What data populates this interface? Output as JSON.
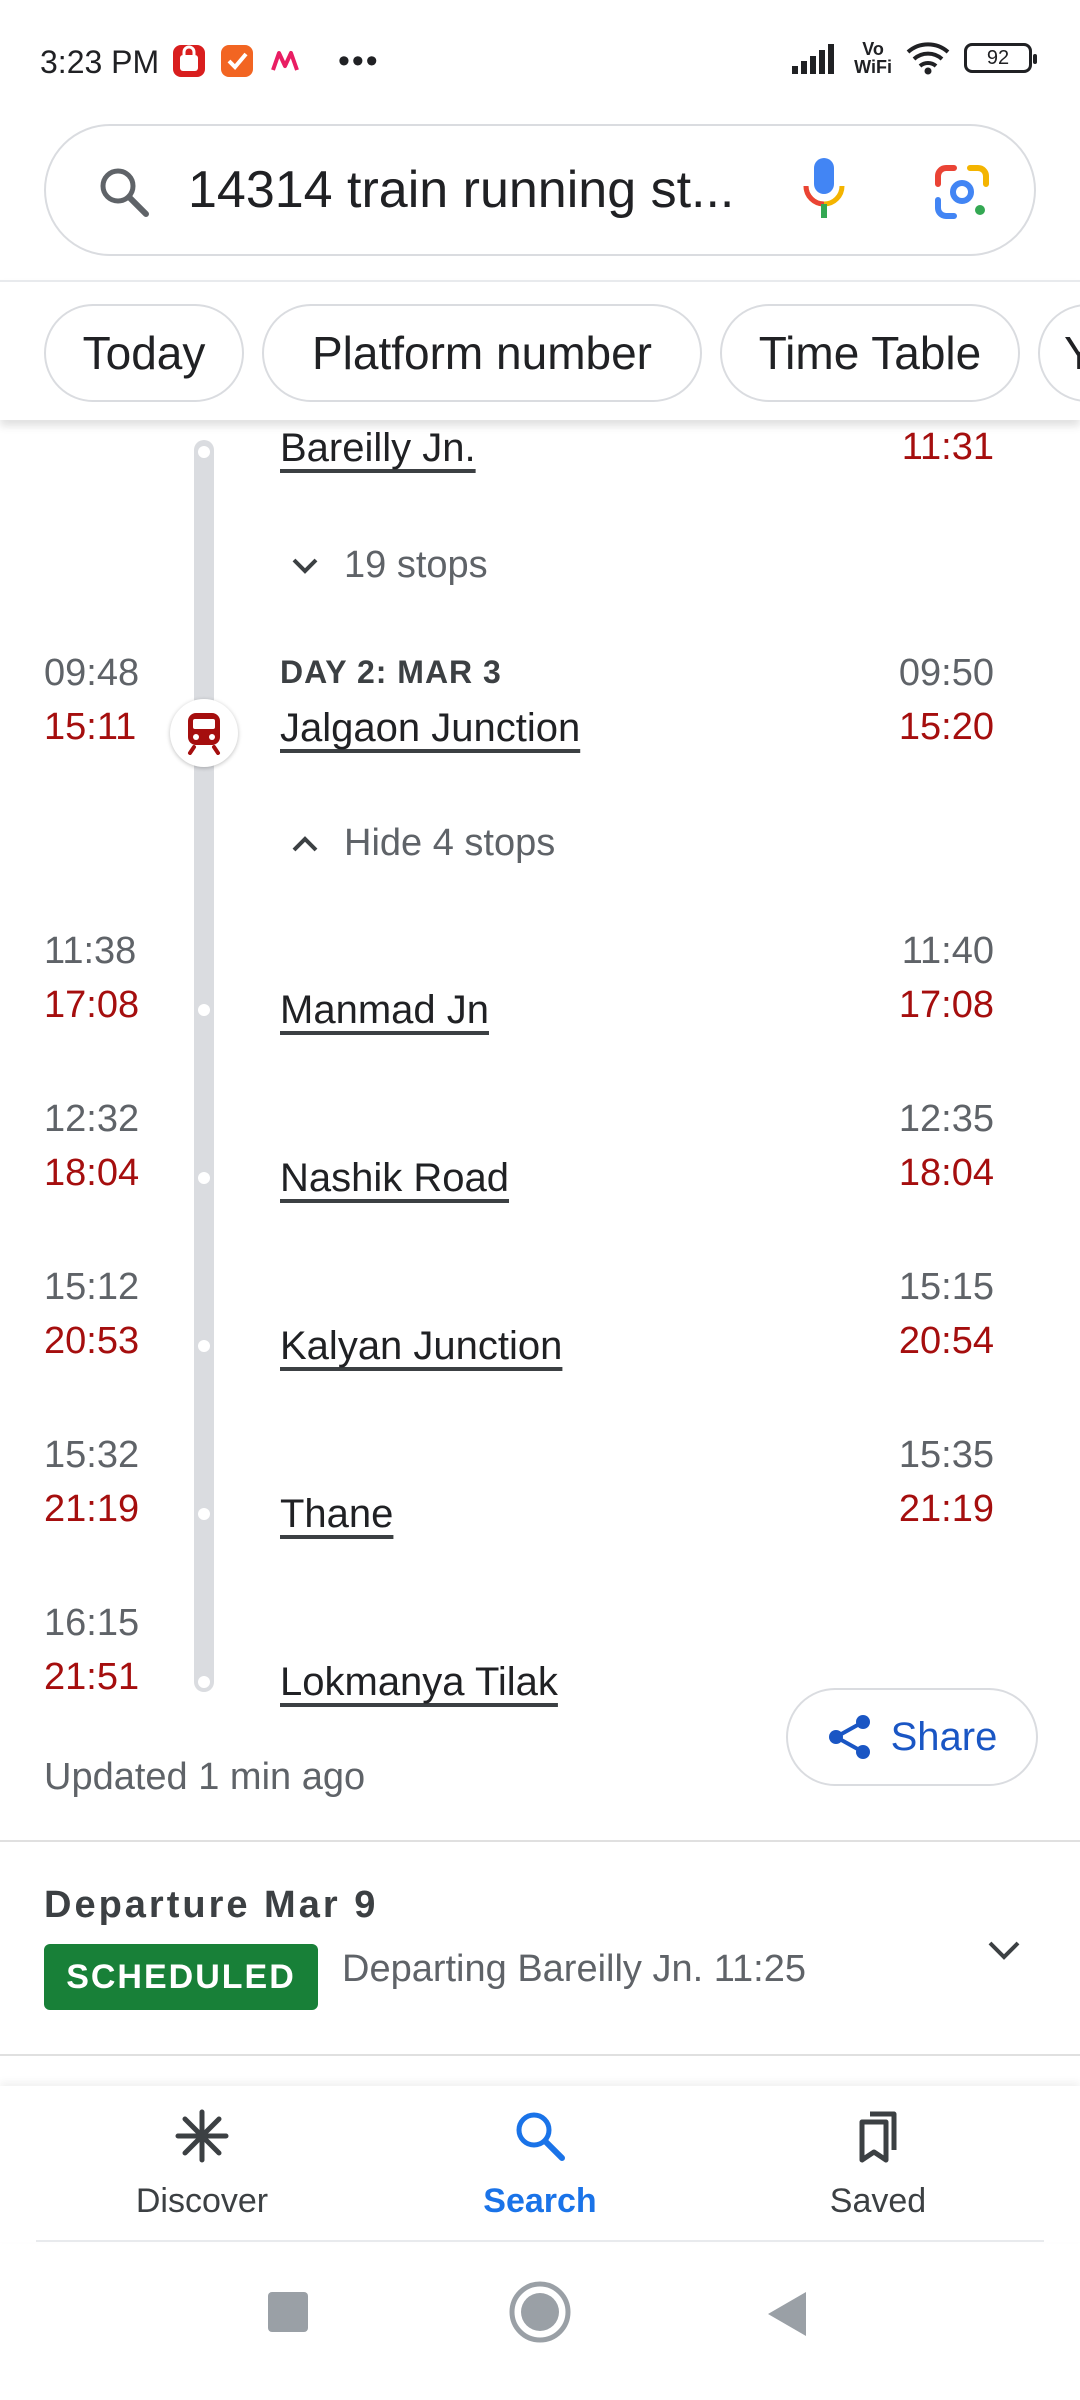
{
  "status_bar": {
    "time": "3:23 PM",
    "battery": "92",
    "volte_line1": "Vo",
    "volte_line2": "WiFi"
  },
  "search": {
    "query": "14314 train running st..."
  },
  "chips": [
    {
      "label": "Today"
    },
    {
      "label": "Platform number"
    },
    {
      "label": "Time Table"
    },
    {
      "label": "Y"
    }
  ],
  "timeline": {
    "top_station": {
      "name": "Bareilly Jn.",
      "actual_departure": "11:31"
    },
    "collapsed_toggle": "19 stops",
    "current_stop": {
      "day_label": "DAY 2: MAR 3",
      "name": "Jalgaon Junction",
      "sched_arrival": "09:48",
      "actual_arrival": "15:11",
      "sched_departure": "09:50",
      "actual_departure": "15:20"
    },
    "expanded_toggle": "Hide 4 stops",
    "stops": [
      {
        "name": "Manmad Jn",
        "sched_arrival": "11:38",
        "actual_arrival": "17:08",
        "sched_departure": "11:40",
        "actual_departure": "17:08"
      },
      {
        "name": "Nashik Road",
        "sched_arrival": "12:32",
        "actual_arrival": "18:04",
        "sched_departure": "12:35",
        "actual_departure": "18:04"
      },
      {
        "name": "Kalyan Junction",
        "sched_arrival": "15:12",
        "actual_arrival": "20:53",
        "sched_departure": "15:15",
        "actual_departure": "20:54"
      },
      {
        "name": "Thane",
        "sched_arrival": "15:32",
        "actual_arrival": "21:19",
        "sched_departure": "15:35",
        "actual_departure": "21:19"
      },
      {
        "name": "Lokmanya Tilak",
        "sched_arrival": "16:15",
        "actual_arrival": "21:51"
      }
    ]
  },
  "updated_text": "Updated 1 min ago",
  "share_label": "Share",
  "departure": {
    "title": "Departure Mar 9",
    "status_badge": "SCHEDULED",
    "description": "Departing Bareilly Jn. 11:25"
  },
  "bottom_nav": {
    "discover": "Discover",
    "search": "Search",
    "saved": "Saved"
  },
  "colors": {
    "actual_time": "#a50e0e",
    "accent_blue": "#1a73e8",
    "badge_green": "#188038"
  }
}
